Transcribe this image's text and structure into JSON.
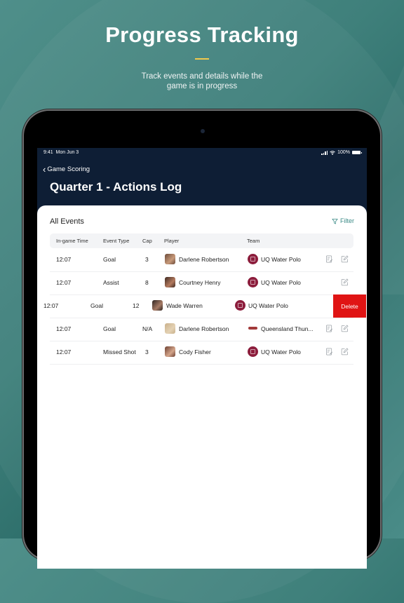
{
  "hero": {
    "title": "Progress Tracking",
    "subtitle": "Track events and details while the game is in progress",
    "accent_color": "#f2c94c"
  },
  "status_bar": {
    "time": "9:41",
    "date": "Mon Jun 3",
    "battery": "100%"
  },
  "nav": {
    "back_label": "Game Scoring",
    "page_title": "Quarter 1 - Actions Log"
  },
  "card": {
    "title": "All Events",
    "filter_label": "Filter"
  },
  "table": {
    "columns": [
      "In-game Time",
      "Event Type",
      "Cap",
      "Player",
      "Team"
    ],
    "rows": [
      {
        "time": "12:07",
        "event": "Goal",
        "cap": "3",
        "player": "Darlene Robertson",
        "team": "UQ Water Polo",
        "team_logo": "uq",
        "notes_icon": true,
        "swiped": false
      },
      {
        "time": "12:07",
        "event": "Assist",
        "cap": "8",
        "player": "Courtney Henry",
        "team": "UQ Water Polo",
        "team_logo": "uq",
        "notes_icon": false,
        "swiped": false
      },
      {
        "time": "12:07",
        "event": "Goal",
        "cap": "12",
        "player": "Wade Warren",
        "team": "UQ Water Polo",
        "team_logo": "uq",
        "notes_icon": false,
        "swiped": true
      },
      {
        "time": "12:07",
        "event": "Goal",
        "cap": "N/A",
        "player": "Darlene Robertson",
        "team": "Queensland Thun...",
        "team_logo": "qld",
        "notes_icon": true,
        "swiped": false
      },
      {
        "time": "12:07",
        "event": "Missed Shot",
        "cap": "3",
        "player": "Cody Fisher",
        "team": "UQ Water Polo",
        "team_logo": "uq",
        "notes_icon": true,
        "swiped": false
      }
    ],
    "delete_label": "Delete",
    "delete_color": "#e01414"
  },
  "icons": {
    "back": "chevron-left-icon",
    "filter": "filter-funnel-icon",
    "notes": "notes-icon",
    "edit": "edit-icon"
  }
}
